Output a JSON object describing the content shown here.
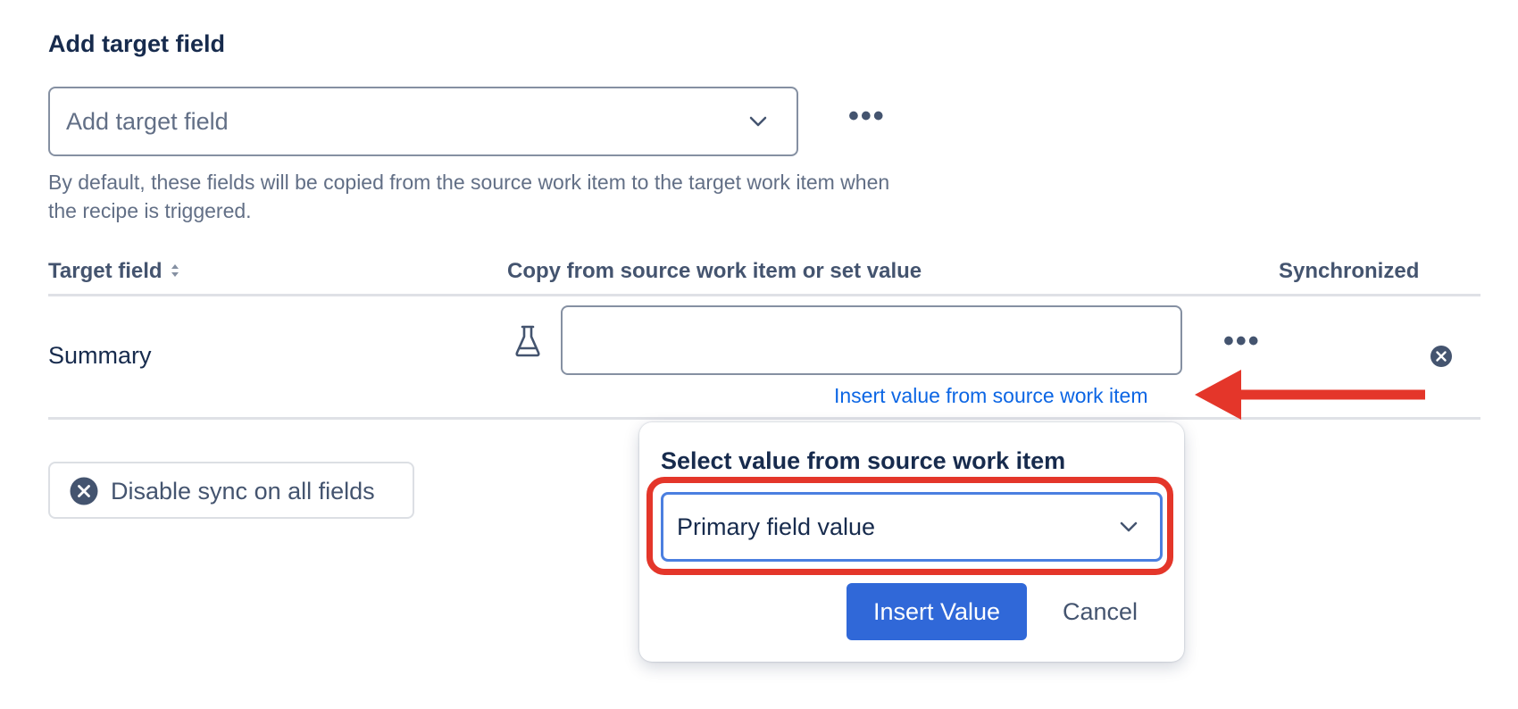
{
  "section": {
    "title": "Add target field",
    "select_placeholder": "Add target field",
    "more_label": "•••",
    "helper_text": "By default, these fields will be copied from the source work item to the target work item when the recipe is triggered."
  },
  "table": {
    "headers": {
      "target_field": "Target field",
      "copy_from": "Copy from source work item or set value",
      "synchronized": "Synchronized"
    },
    "rows": [
      {
        "field": "Summary",
        "value": "",
        "insert_link": "Insert value from source work item",
        "more_label": "•••"
      }
    ]
  },
  "disable_sync_button": "Disable sync on all fields",
  "popup": {
    "title": "Select value from source work item",
    "selected_value": "Primary field value",
    "insert_button": "Insert Value",
    "cancel_button": "Cancel"
  },
  "colors": {
    "link": "#0c66e4",
    "primary_button": "#3068d8",
    "annotation_red": "#e4362a",
    "focus_border": "#4b7fe0"
  },
  "icons": [
    "chevron-down-icon",
    "more-icon",
    "sort-icon",
    "flask-icon",
    "clear-icon",
    "x-circle-icon",
    "annotation-arrow"
  ]
}
